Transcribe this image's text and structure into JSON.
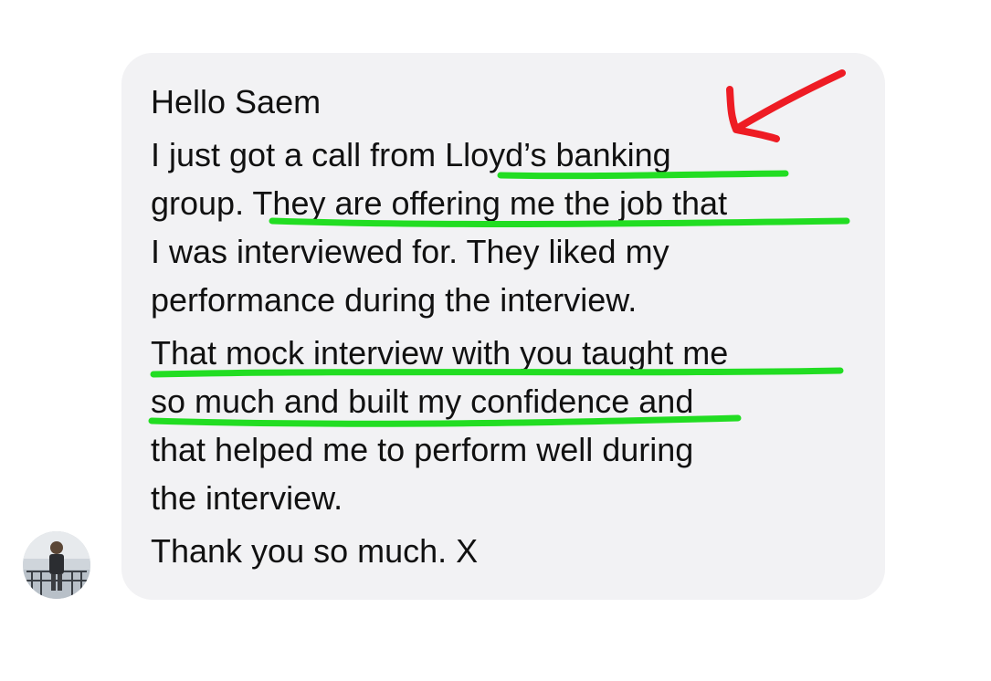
{
  "conversation": {
    "lines": [
      "Hello Saem",
      "I just got a call from Lloyd’s banking",
      "group. They are offering me the job that",
      "I was interviewed for. They liked my",
      "performance during the interview.",
      "That mock interview with you taught me",
      "so much and built my confidence and",
      "that helped me to perform well during",
      "the interview.",
      "Thank you so much. X"
    ]
  },
  "annotations": {
    "highlight_color": "#22dd22",
    "arrow_color": "#ee1c24"
  }
}
